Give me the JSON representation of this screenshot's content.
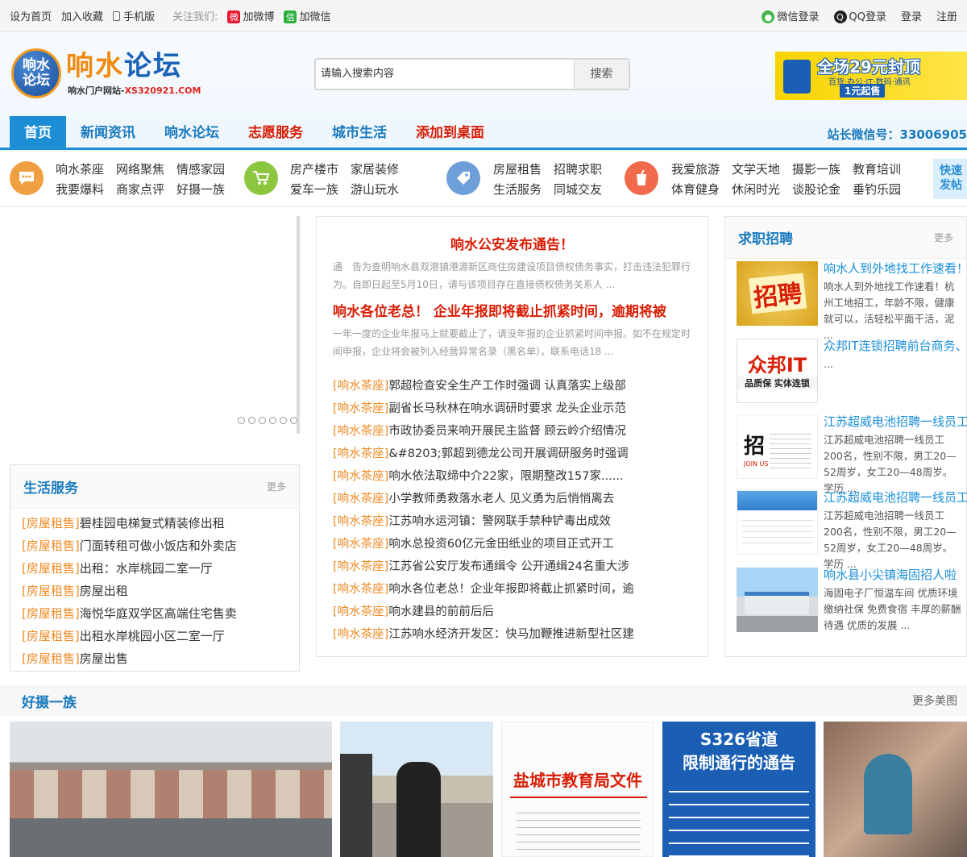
{
  "topbar": {
    "set_home": "设为首页",
    "add_fav": "加入收藏",
    "mobile": "手机版",
    "follow_us": "关注我们:",
    "weibo": "加微博",
    "weixin": "加微信",
    "wechat_login": "微信登录",
    "qq_login": "QQ登录",
    "login": "登录",
    "register": "注册"
  },
  "logo": {
    "badge_line1": "响水",
    "badge_line2": "论坛",
    "name_part1": "响水",
    "name_part2": "论坛",
    "sub_text": "响水门户网站-",
    "sub_domain": "XS320921.COM"
  },
  "search": {
    "placeholder": "请输入搜索内容",
    "button": "搜索"
  },
  "ad": {
    "headline": "全场29元封顶",
    "line2": "百货·办公·IT·数码·通讯",
    "line3": "1元起售"
  },
  "nav": {
    "items": [
      {
        "label": "首页"
      },
      {
        "label": "新闻资讯"
      },
      {
        "label": "响水论坛"
      },
      {
        "label": "志愿服务"
      },
      {
        "label": "城市生活"
      },
      {
        "label": "添加到桌面"
      }
    ],
    "wechat_id": "站长微信号：33006905"
  },
  "categories": [
    {
      "icon": "chat-icon",
      "color": "#f0a040",
      "links": [
        "响水茶座",
        "我要爆料",
        "网络聚焦",
        "商家点评",
        "情感家园",
        "好摄一族"
      ]
    },
    {
      "icon": "cart-icon",
      "color": "#8cc63f",
      "links": [
        "房产楼市",
        "爱车一族",
        "家居装修",
        "游山玩水"
      ]
    },
    {
      "icon": "tag-icon",
      "color": "#6f9fd8",
      "links": [
        "房屋租售",
        "生活服务",
        "招聘求职",
        "同城交友"
      ]
    },
    {
      "icon": "cup-icon",
      "color": "#f06a4b",
      "links": [
        "我爱旅游",
        "体育健身",
        "文学天地",
        "休闲时光",
        "摄影一族",
        "谈股论金",
        "教育培训",
        "垂钓乐园"
      ]
    }
  ],
  "fast_publish": {
    "line1": "快速",
    "line2": "发帖"
  },
  "life": {
    "title": "生活服务",
    "more": "更多",
    "items": [
      {
        "tag": "[房屋租售]",
        "text": "碧桂园电梯复式精装修出租"
      },
      {
        "tag": "[房屋租售]",
        "text": "门面转租可做小饭店和外卖店"
      },
      {
        "tag": "[房屋租售]",
        "text": "出租：水岸桃园二室一厅"
      },
      {
        "tag": "[房屋租售]",
        "text": "房屋出租"
      },
      {
        "tag": "[房屋租售]",
        "text": "海悦华庭双学区高端住宅售卖"
      },
      {
        "tag": "[房屋租售]",
        "text": "出租水岸桃园小区二室一厅"
      },
      {
        "tag": "[房屋租售]",
        "text": "房屋出售"
      }
    ]
  },
  "center": {
    "headline1": "响水公安发布通告！",
    "summary1": "通　告为查明响水县双港镇港源新区商住房建设项目债权债务事实，打击违法犯罪行为。自即日起至5月10日，请与该项目存在直接债权债务关系人 ...",
    "headline2": "响水各位老总！ 企业年报即将截止抓紧时间，逾期将被",
    "summary2": "一年一度的企业年报马上就要截止了，请没年报的企业抓紧时间申报。如不在规定时间申报，企业将会被列入经营异常名录（黑名单）。联系电话18 ...",
    "news": [
      {
        "tag": "[响水茶座]",
        "text": "郭超检查安全生产工作时强调 认真落实上级部"
      },
      {
        "tag": "[响水茶座]",
        "text": "副省长马秋林在响水调研时要求 龙头企业示范"
      },
      {
        "tag": "[响水茶座]",
        "text": "市政协委员来响开展民主监督 顾云岭介绍情况"
      },
      {
        "tag": "[响水茶座]",
        "text": "&#8203;郭超到德龙公司开展调研服务时强调"
      },
      {
        "tag": "[响水茶座]",
        "text": "响水依法取缔中介22家，限期整改157家......"
      },
      {
        "tag": "[响水茶座]",
        "text": "小学教师勇救落水老人 见义勇为后悄悄离去"
      },
      {
        "tag": "[响水茶座]",
        "text": "江苏响水运河镇：警网联手禁种铲毒出成效"
      },
      {
        "tag": "[响水茶座]",
        "text": "响水总投资60亿元金田纸业的项目正式开工"
      },
      {
        "tag": "[响水茶座]",
        "text": "江苏省公安厅发布通缉令 公开通缉24名重大涉"
      },
      {
        "tag": "[响水茶座]",
        "text": "响水各位老总！企业年报即将截止抓紧时间，逾"
      },
      {
        "tag": "[响水茶座]",
        "text": "响水建县的前前后后"
      },
      {
        "tag": "[响水茶座]",
        "text": "江苏响水经济开发区：快马加鞭推进新型社区建"
      }
    ]
  },
  "jobs": {
    "title": "求职招聘",
    "more": "更多",
    "items": [
      {
        "title": "响水人到外地找工作速看！",
        "desc": "响水人到外地找工作速看！杭州工地招工，年龄不限，健康就可以，活轻松平面干活，泥 ...",
        "thumb_text": "招聘"
      },
      {
        "title": "众邦IT连锁招聘前台商务、",
        "desc": "...",
        "thumb_text": "众邦IT",
        "thumb_sub": "品质保 实体连锁"
      },
      {
        "title": "江苏超威电池招聘一线员工",
        "desc": "江苏超威电池招聘一线员工200名，性别不限，男工20—52周岁，女工20—48周岁。学历 ...",
        "thumb_text": "招",
        "thumb_sub": "JOIN US"
      },
      {
        "title": "江苏超威电池招聘一线员工",
        "desc": "江苏超威电池招聘一线员工200名，性别不限，男工20—52周岁，女工20—48周岁。学历 ...",
        "thumb_text": ""
      },
      {
        "title": "响水县小尖镇海固招人啦",
        "desc": "海固电子厂恒温车间 优质环境 缴纳社保 免费食宿 丰厚的薪酬待遇 优质的发展 ...",
        "thumb_text": ""
      }
    ]
  },
  "photos": {
    "title": "好摄一族",
    "more": "更多美图",
    "doc_title": "盐城市教育局文件",
    "notice_title1": "S326省道",
    "notice_title2": "限制通行的通告"
  }
}
